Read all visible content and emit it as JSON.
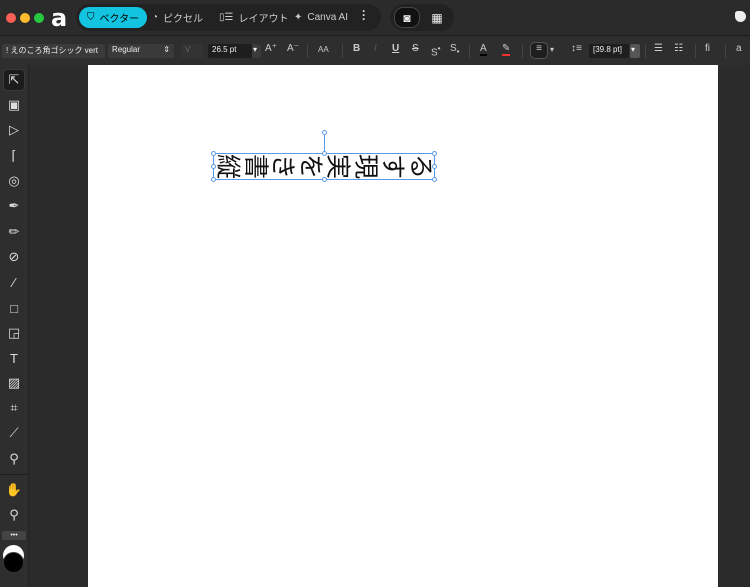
{
  "titlebar": {
    "personas": [
      {
        "label": "ベクター",
        "icon": "vector-icon",
        "active": true
      },
      {
        "label": "ピクセル",
        "icon": "pixel-icon",
        "active": false
      },
      {
        "label": "レイアウト",
        "icon": "layout-icon",
        "active": false
      },
      {
        "label": "Canva AI",
        "icon": "sparkle-icon",
        "active": false
      }
    ],
    "accent": "#12c4e0"
  },
  "context_toolbar": {
    "font_family": "! えのころ角ゴシック vert",
    "font_style": "Regular",
    "font_size": "26.5 pt",
    "case_label": "AA",
    "bold": "B",
    "italic": "I",
    "underline": "U",
    "strike": "S",
    "superscript": "S",
    "subscript": "S",
    "leading": "[39.8 pt]",
    "ligature": "fi",
    "glyph": "a"
  },
  "canvas": {
    "text_frame": [
      "縦",
      "書",
      "き",
      "を",
      "実",
      "現",
      "す",
      "る"
    ]
  },
  "tools": [
    "pointer-icon",
    "artboard-icon",
    "node-icon",
    "corner-icon",
    "point-transform-icon",
    "pen-icon",
    "pencil-icon",
    "vector-brush-icon",
    "fill-icon",
    "rectangle-icon",
    "marquee-icon",
    "frame-text-icon",
    "image-icon",
    "crop-icon",
    "measure-icon",
    "color-picker-icon",
    "hand-icon",
    "zoom-icon"
  ],
  "more_tools_label": "•••"
}
